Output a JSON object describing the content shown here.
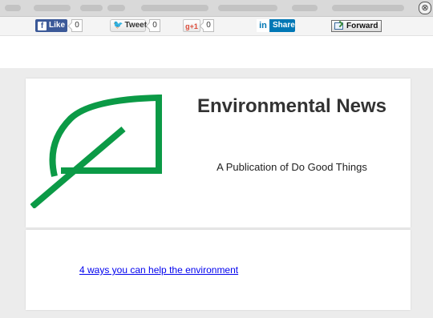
{
  "share": {
    "like_label": "Like",
    "like_count": "0",
    "tweet_label": "Tweet",
    "tweet_count": "0",
    "gplus_label": "g+1",
    "gplus_count": "0",
    "linkedin_label": "Share",
    "forward_label": "Forward"
  },
  "header": {
    "title": "Environmental News",
    "subtitle": "A Publication of Do Good Things"
  },
  "content": {
    "link_text": "4 ways you can help the environment"
  },
  "colors": {
    "leaf": "#0b9a46",
    "facebook": "#3b5998",
    "linkedin": "#0077b5",
    "link": "#0000ee"
  }
}
